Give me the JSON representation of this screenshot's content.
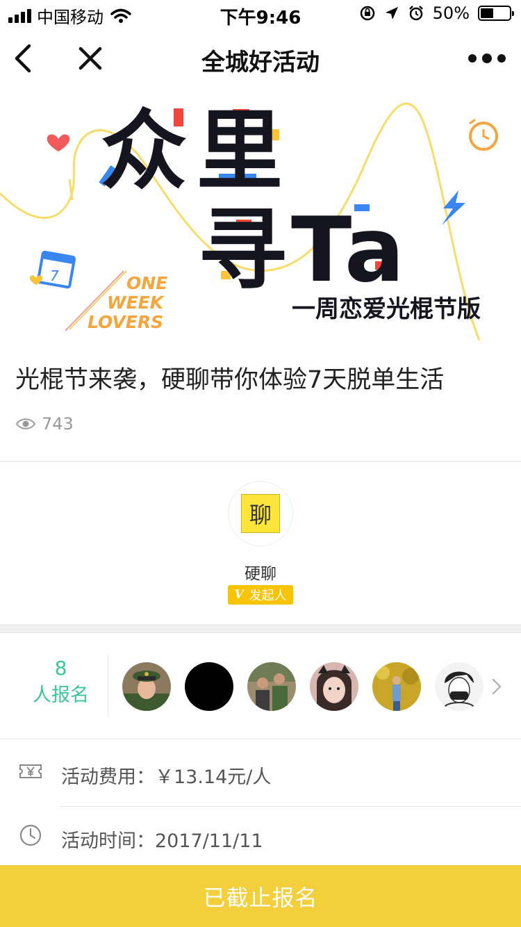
{
  "status_bar": {
    "carrier": "中国移动",
    "time": "下午9:46",
    "battery": "50%",
    "battery_level": 0.5
  },
  "nav": {
    "title": "全城好活动"
  },
  "banner": {
    "title_line1": "众里",
    "title_line2": "寻Ta",
    "subtitle": "一周恋爱光棍节版",
    "side_text": [
      "ONE",
      "WEEK",
      "LOVERS"
    ],
    "calendar_day": "7"
  },
  "article": {
    "title": "光棍节来袭，硬聊带你体验7天脱单生活",
    "views": "743"
  },
  "organizer": {
    "logo_char": "聊",
    "name": "硬聊",
    "badge_v": "V",
    "badge_label": "发起人"
  },
  "participants": {
    "count": "8",
    "label": "人报名"
  },
  "info": {
    "fee_label": "活动费用：",
    "fee_value": "￥13.14元/人",
    "time_label": "活动时间：",
    "time_value": "2017/11/11"
  },
  "action": {
    "button_label": "已截止报名"
  },
  "colors": {
    "accent_yellow": "#f2cf3b",
    "badge_yellow": "#f8c300",
    "count_green": "#3cc59a",
    "banner_blue": "#3a86f0",
    "banner_red": "#f0473c",
    "banner_orange": "#f4a53c"
  }
}
